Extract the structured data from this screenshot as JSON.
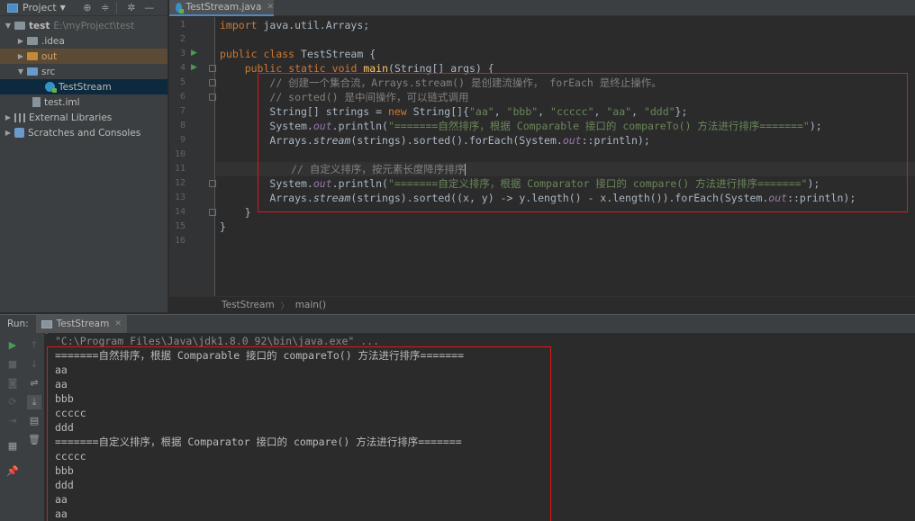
{
  "project_panel": {
    "title": "Project",
    "tree": [
      {
        "name": "test",
        "path": "E:\\myProject\\test"
      },
      {
        "name": ".idea"
      },
      {
        "name": "out"
      },
      {
        "name": "src"
      },
      {
        "name": "TestStream"
      },
      {
        "name": "test.iml"
      },
      {
        "name": "External Libraries"
      },
      {
        "name": "Scratches and Consoles"
      }
    ]
  },
  "editor": {
    "tab_label": "TestStream.java",
    "line_numbers": [
      "1",
      "2",
      "3",
      "4",
      "5",
      "6",
      "7",
      "8",
      "9",
      "10",
      "11",
      "12",
      "13",
      "14",
      "15",
      "16"
    ],
    "code": {
      "l1": {
        "kw": "import",
        "rest": " java.util.Arrays;"
      },
      "l3": {
        "kw1": "public",
        "kw2": "class",
        "rest": " TestStream {"
      },
      "l4": {
        "kw1": "public",
        "kw2": "static",
        "kw3": "void",
        "fn": "main",
        "rest": "(String[] args) {"
      },
      "l5": "// 创建一个集合流，Arrays.stream() 是创建流操作， forEach 是终止操作。",
      "l6": "// sorted() 是中间操作，可以链式调用",
      "l7": {
        "a": "String[] strings = ",
        "kw": "new",
        "b": " String[]{",
        "s1": "\"aa\"",
        "s2": "\"bbb\"",
        "s3": "\"ccccc\"",
        "s4": "\"aa\"",
        "s5": "\"ddd\"",
        "sep": ", ",
        "end": "};"
      },
      "l8": {
        "a": "System.",
        "fld": "out",
        "b": ".println(",
        "s": "\"=======自然排序，根据 Comparable 接口的 compareTo() 方法进行排序=======\"",
        "end": ");"
      },
      "l9": {
        "a": "Arrays.",
        "it": "stream",
        "b": "(strings).sorted().forEach(System.",
        "fld": "out",
        "end": "::println);"
      },
      "l11": "// 自定义排序，按元素长度降序排序",
      "l12": {
        "a": "System.",
        "fld": "out",
        "b": ".println(",
        "s": "\"=======自定义排序，根据 Comparator 接口的 compare() 方法进行排序=======\"",
        "end": ");"
      },
      "l13": {
        "a": "Arrays.",
        "it": "stream",
        "b": "(strings).sorted((x, y) -> y.length() - x.length()).forEach(System.",
        "fld": "out",
        "end": "::println);"
      },
      "l14": "}",
      "l15": "}"
    },
    "breadcrumb": [
      "TestStream",
      "main()"
    ]
  },
  "run_window": {
    "label": "Run:",
    "tab_label": "TestStream",
    "output": [
      "\"C:\\Program Files\\Java\\jdk1.8.0_92\\bin\\java.exe\" ...",
      "=======自然排序，根据 Comparable 接口的 compareTo() 方法进行排序=======",
      "aa",
      "aa",
      "bbb",
      "ccccc",
      "ddd",
      "=======自定义排序，根据 Comparator 接口的 compare() 方法进行排序=======",
      "ccccc",
      "bbb",
      "ddd",
      "aa",
      "aa"
    ]
  },
  "colors": {
    "highlight_box": "#e0161b",
    "keyword": "#cc7832",
    "string": "#6a8759",
    "comment": "#808080",
    "field": "#9876aa",
    "method_decl": "#ffc66d"
  }
}
